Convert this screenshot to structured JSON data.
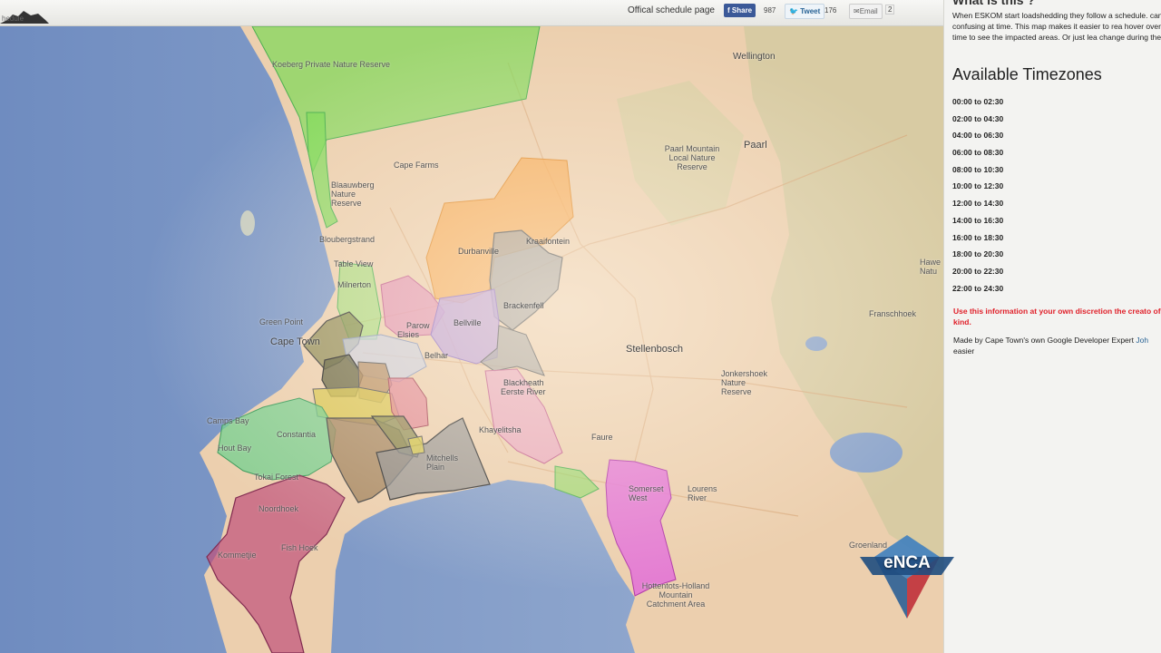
{
  "header": {
    "logo_text": "hedule",
    "schedule_link": "Offical schedule page",
    "share": {
      "facebook_label": "Share",
      "facebook_count": "987",
      "tweet_label": "Tweet",
      "tweet_count": "176",
      "email_label": "Email",
      "email_count": "2"
    }
  },
  "sidebar": {
    "heading_partial": "What is this ?",
    "intro": "When ESKOM start loadshedding they follow a schedule. can be confusing at time. This map makes it easier to rea hover over the time to see the impacted areas. Or just lea change during the day.",
    "title": "Available Timezones",
    "timezones": [
      "00:00 to 02:30",
      "02:00 to 04:30",
      "04:00 to 06:30",
      "06:00 to 08:30",
      "08:00 to 10:30",
      "10:00 to 12:30",
      "12:00 to 14:30",
      "14:00 to 16:30",
      "16:00 to 18:30",
      "18:00 to 20:30",
      "20:00 to 22:30",
      "22:00 to 24:30"
    ],
    "warning": "Use this information at your own discretion the creato of any kind.",
    "madeby_prefix": "Made by Cape Town's own Google Developer Expert",
    "madeby_link": "Joh",
    "madeby_suffix": "easier"
  },
  "map": {
    "labels": {
      "koeberg": "Koeberg Private Nature Reserve",
      "wellington": "Wellington",
      "capefarms": "Cape Farms",
      "blaauwberg": "Blaauwberg Nature Reserve",
      "paarlmountain": "Paarl Mountain Local Nature Reserve",
      "paarl": "Paarl",
      "bloubergstrand": "Bloubergstrand",
      "durbanville": "Durbanville",
      "table_view": "Table View",
      "milnerton": "Milnerton",
      "kraaifontein": "Kraaifontein",
      "greenpoint": "Green Point",
      "capetown": "Cape Town",
      "parow": "Parow",
      "elsies": "Elsies",
      "bellville": "Bellville",
      "belhar": "Belhar",
      "brackenfell": "Brackenfell",
      "stellenbosch": "Stellenbosch",
      "jonkershoek": "Jonkershoek Nature Reserve",
      "franschhoek": "Franschhoek",
      "hawequa": "Hawe Natu",
      "camps_bay": "Camps Bay",
      "constantia": "Constantia",
      "hout_bay": "Hout Bay",
      "tokai": "Tokai Forest",
      "mitchells": "Mitchells Plain",
      "khayelitsha": "Khayelitsha",
      "blackheath": "Blackheath",
      "eersteriver": "Eerste River",
      "faure": "Faure",
      "somersetwest": "Somerset West",
      "lourens": "Lourens River",
      "hottentots": "Hottentots-Holland Mountain Catchment Area",
      "noordhoek": "Noordhoek",
      "kommetjie": "Kommetjie",
      "fishhoek": "Fish Hoek",
      "groenland": "Groenland"
    }
  },
  "watermark": {
    "text": "eNCA"
  },
  "colors": {
    "ocean": "#8ea6cc",
    "land": "#eccfae",
    "green_zone": "#7ed957",
    "orange_zone": "#f7a64a",
    "pink_zone": "#e08ab0",
    "magenta_zone": "#e36fd8",
    "purple_zone": "#b89ad8",
    "gray_zone": "#9a9a98",
    "warning": "#e0202a"
  }
}
